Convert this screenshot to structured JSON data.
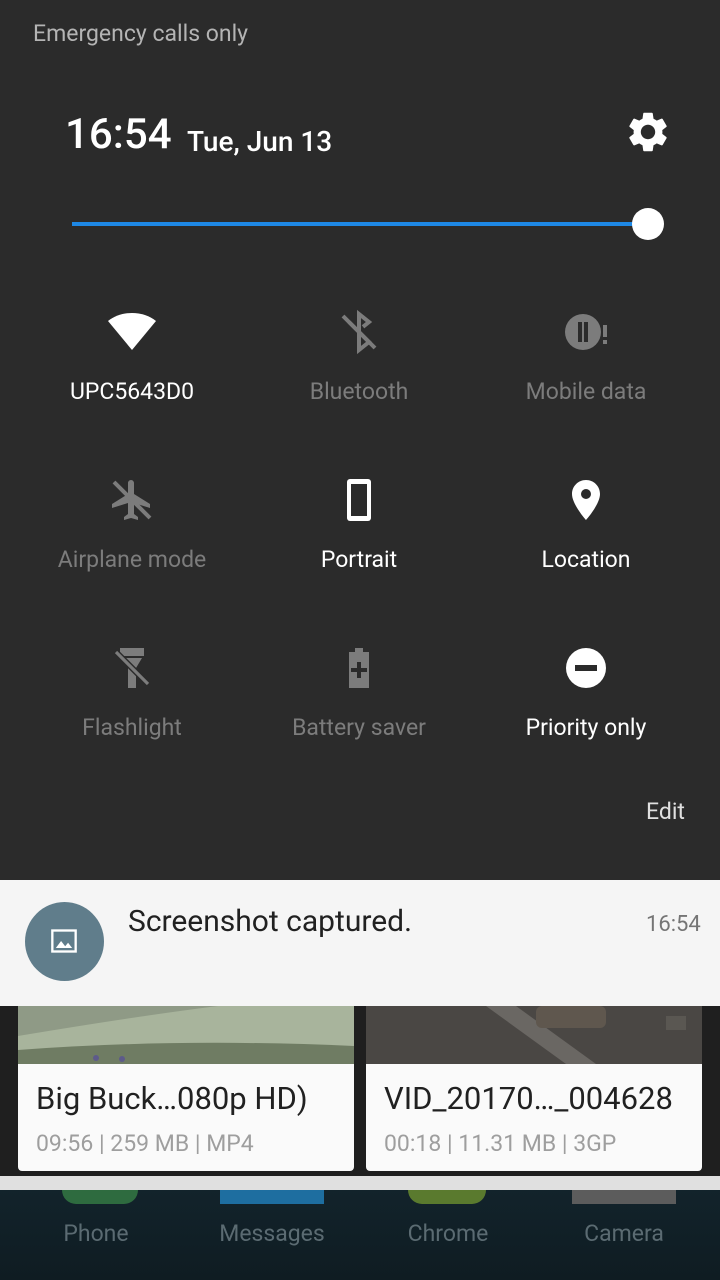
{
  "status": {
    "carrier": "Emergency calls only"
  },
  "header": {
    "time": "16:54",
    "date": "Tue, Jun 13"
  },
  "brightness": {
    "level": 1.0
  },
  "tiles": [
    {
      "label": "UPC5643D0",
      "icon": "wifi-icon",
      "on": true
    },
    {
      "label": "Bluetooth",
      "icon": "bluetooth-off-icon",
      "on": false
    },
    {
      "label": "Mobile data",
      "icon": "mobile-data-icon",
      "on": false
    },
    {
      "label": "Airplane mode",
      "icon": "airplane-icon",
      "on": false
    },
    {
      "label": "Portrait",
      "icon": "portrait-icon",
      "on": true
    },
    {
      "label": "Location",
      "icon": "location-icon",
      "on": true
    },
    {
      "label": "Flashlight",
      "icon": "flashlight-off-icon",
      "on": false
    },
    {
      "label": "Battery saver",
      "icon": "battery-saver-icon",
      "on": false
    },
    {
      "label": "Priority only",
      "icon": "priority-only-icon",
      "on": true
    }
  ],
  "edit_label": "Edit",
  "notification": {
    "title": "Screenshot captured.",
    "time": "16:54",
    "icon": "image-icon"
  },
  "videos": [
    {
      "title": "Big Buck…080p HD)",
      "meta": "09:56 | 259 MB | MP4"
    },
    {
      "title": "VID_20170…_004628",
      "meta": "00:18 | 11.31 MB | 3GP"
    }
  ],
  "dock": [
    "Phone",
    "Messages",
    "Chrome",
    "Camera"
  ]
}
